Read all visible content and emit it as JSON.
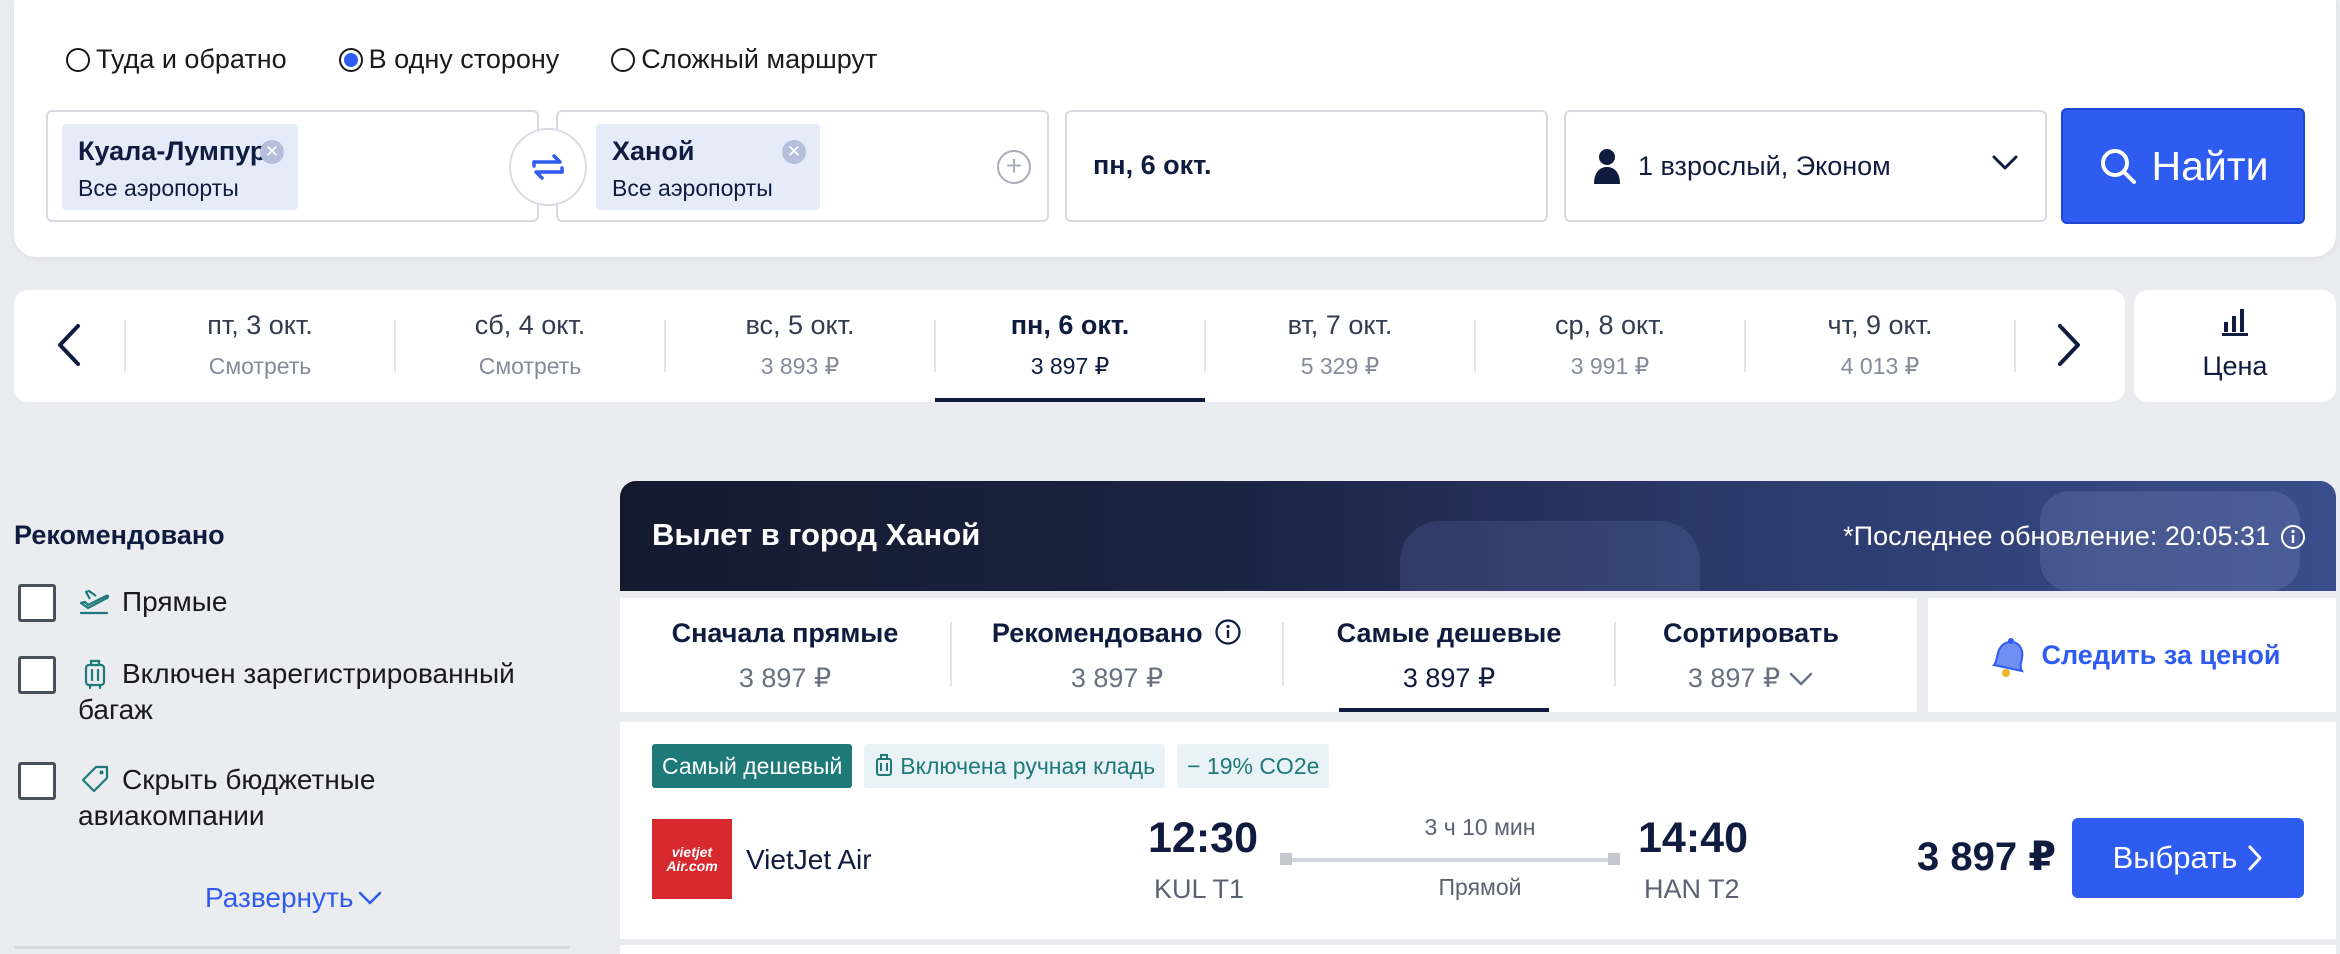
{
  "trip_types": [
    {
      "label": "Туда и обратно",
      "checked": false
    },
    {
      "label": "В одну сторону",
      "checked": true
    },
    {
      "label": "Сложный маршрут",
      "checked": false
    }
  ],
  "search": {
    "from": {
      "city": "Куала-Лумпур",
      "airports": "Все аэропорты"
    },
    "to": {
      "city": "Ханой",
      "airports": "Все аэропорты"
    },
    "date": "пн, 6 окт.",
    "passengers": "1 взрослый, Эконом",
    "button_label": "Найти"
  },
  "date_strip": {
    "days": [
      {
        "label": "пт, 3 окт.",
        "price": "Смотреть",
        "active": false
      },
      {
        "label": "сб, 4 окт.",
        "price": "Смотреть",
        "active": false
      },
      {
        "label": "вс, 5 окт.",
        "price": "3 893 ₽",
        "active": false
      },
      {
        "label": "пн, 6 окт.",
        "price": "3 897 ₽",
        "active": true
      },
      {
        "label": "вт, 7 окт.",
        "price": "5 329 ₽",
        "active": false
      },
      {
        "label": "ср, 8 окт.",
        "price": "3 991 ₽",
        "active": false
      },
      {
        "label": "чт, 9 окт.",
        "price": "4 013 ₽",
        "active": false
      }
    ],
    "price_panel_label": "Цена"
  },
  "filters": {
    "title": "Рекомендовано",
    "items": [
      {
        "label": "Прямые",
        "icon": "plane-takeoff-icon"
      },
      {
        "label_line1": "Включен зарегистрированный",
        "label_line2": "багаж",
        "icon": "luggage-icon"
      },
      {
        "label_line1": "Скрыть бюджетные",
        "label_line2": "авиакомпании",
        "icon": "tag-icon"
      }
    ],
    "expand_label": "Развернуть"
  },
  "results": {
    "header_title": "Вылет в город Ханой",
    "last_update": "*Последнее обновление: 20:05:31",
    "sort_tabs": [
      {
        "label": "Сначала прямые",
        "price": "3 897 ₽",
        "active": false
      },
      {
        "label": "Рекомендовано",
        "price": "3 897 ₽",
        "active": false,
        "info": true
      },
      {
        "label": "Самые дешевые",
        "price": "3 897 ₽",
        "active": true
      },
      {
        "label": "Сортировать",
        "price": "3 897 ₽",
        "active": false,
        "dropdown": true
      }
    ],
    "watch_price_label": "Следить за ценой"
  },
  "ticket": {
    "badges": [
      "Самый дешевый",
      "Включена ручная кладь",
      "− 19% CO2e"
    ],
    "airline": "VietJet Air",
    "logo_line1": "vietjet",
    "logo_line2": "Air.com",
    "departure_time": "12:30",
    "departure_code": "KUL T1",
    "arrival_time": "14:40",
    "arrival_code": "HAN T2",
    "duration": "3 ч 10 мин",
    "stops": "Прямой",
    "price": "3 897 ₽",
    "select_label": "Выбрать"
  },
  "colors": {
    "accent": "#2e5bf0",
    "badge_green": "#1e7a78",
    "airline_red": "#d8292f",
    "dark_navy": "#0f1c3f"
  }
}
